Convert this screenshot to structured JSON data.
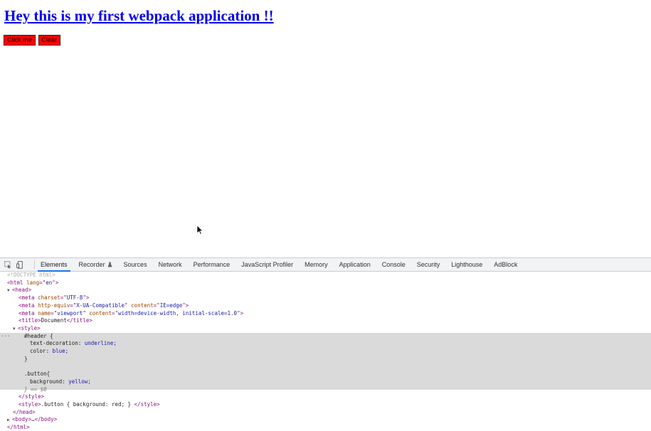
{
  "page": {
    "header_text": "Hey this is my first webpack application !!",
    "buttons": [
      {
        "label": "Click me"
      },
      {
        "label": "Clear"
      }
    ]
  },
  "devtools": {
    "tabs": [
      {
        "label": "Elements",
        "active": true
      },
      {
        "label": "Recorder",
        "experimental": true
      },
      {
        "label": "Sources"
      },
      {
        "label": "Network"
      },
      {
        "label": "Performance"
      },
      {
        "label": "JavaScript Profiler"
      },
      {
        "label": "Memory"
      },
      {
        "label": "Application"
      },
      {
        "label": "Console"
      },
      {
        "label": "Security"
      },
      {
        "label": "Lighthouse"
      },
      {
        "label": "AdBlock"
      }
    ],
    "dom": {
      "doctype": "<!DOCTYPE html>",
      "html_lang": "en",
      "meta_charset": "UTF-8",
      "meta_http_equiv": "X-UA-Compatible",
      "meta_http_equiv_content": "IE=edge",
      "meta_name": "viewport",
      "meta_name_content": "width=device-width, initial-scale=1.0",
      "title": "Document",
      "css_header_selector": "#header {",
      "css_decl_1_prop": "text-decoration",
      "css_decl_1_val": "underline;",
      "css_decl_2_prop": "color",
      "css_decl_2_val": "blue;",
      "css_close": "}",
      "css_button_selector": ".button{",
      "css_decl_3_prop": "background",
      "css_decl_3_val": "yellow;",
      "css_close_eq": "} == $0",
      "style2_content": ".button { background: red; }",
      "body_collapsed": "…"
    }
  },
  "colors": {
    "header_link": "#0000ee",
    "button_bg": "#ff0000",
    "active_tab_underline": "#1a73e8"
  },
  "icons": [
    "inspect-element-icon",
    "device-toolbar-icon",
    "flask-icon",
    "mouse-cursor-icon"
  ]
}
